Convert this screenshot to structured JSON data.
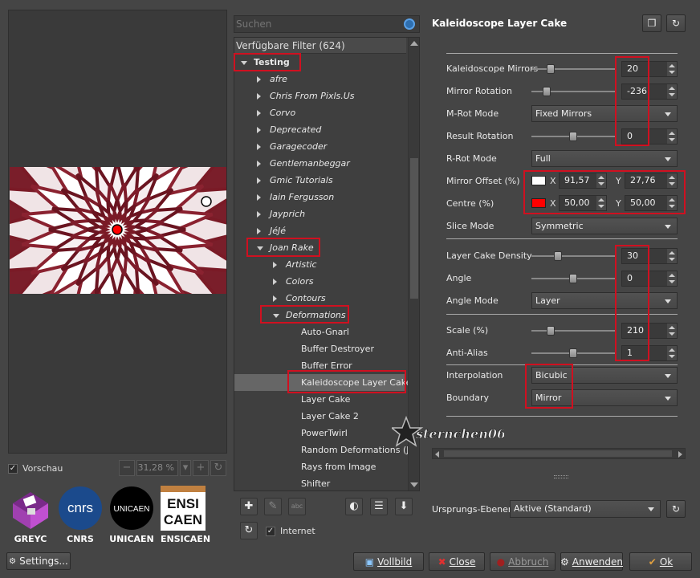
{
  "preview": {
    "checkbox_label": "Vorschau",
    "zoom_value": "31,28 %"
  },
  "logos": [
    {
      "label": "GREYC"
    },
    {
      "label": "CNRS",
      "text": "cnrs"
    },
    {
      "label": "UNICAEN",
      "text": "UNICAEN"
    },
    {
      "label": "ENSICAEN",
      "text1": "ENSI",
      "text2": "CAEN"
    }
  ],
  "settings_label": "Settings...",
  "search": {
    "placeholder": "Suchen"
  },
  "tree": {
    "header": "Verfügbare Filter (624)",
    "items": [
      {
        "label": "Testing",
        "level": 0,
        "expanded": true,
        "bold": true
      },
      {
        "label": "afre",
        "level": 1,
        "expanded": false
      },
      {
        "label": "Chris From Pixls.Us",
        "level": 1,
        "expanded": false
      },
      {
        "label": "Corvo",
        "level": 1,
        "expanded": false
      },
      {
        "label": "Deprecated",
        "level": 1,
        "expanded": false
      },
      {
        "label": "Garagecoder",
        "level": 1,
        "expanded": false
      },
      {
        "label": "Gentlemanbeggar",
        "level": 1,
        "expanded": false
      },
      {
        "label": "Gmic Tutorials",
        "level": 1,
        "expanded": false
      },
      {
        "label": "Iain Fergusson",
        "level": 1,
        "expanded": false
      },
      {
        "label": "Jayprich",
        "level": 1,
        "expanded": false
      },
      {
        "label": "JéJé",
        "level": 1,
        "expanded": false
      },
      {
        "label": "Joan Rake",
        "level": 1,
        "expanded": true
      },
      {
        "label": "Artistic",
        "level": 2,
        "expanded": false
      },
      {
        "label": "Colors",
        "level": 2,
        "expanded": false
      },
      {
        "label": "Contours",
        "level": 2,
        "expanded": false
      },
      {
        "label": "Deformations",
        "level": 2,
        "expanded": true
      },
      {
        "label": "Auto-Gnarl",
        "level": 3
      },
      {
        "label": "Buffer Destroyer",
        "level": 3
      },
      {
        "label": "Buffer Error",
        "level": 3
      },
      {
        "label": "Kaleidoscope Layer Cake",
        "level": 3,
        "selected": true
      },
      {
        "label": "Layer Cake",
        "level": 3
      },
      {
        "label": "Layer Cake 2",
        "level": 3
      },
      {
        "label": "PowerTwirl",
        "level": 3
      },
      {
        "label": "Random Deformations (JR's",
        "level": 3
      },
      {
        "label": "Rays from Image",
        "level": 3
      },
      {
        "label": "Shifter",
        "level": 3
      }
    ]
  },
  "tree_tools": {
    "internet_label": "Internet"
  },
  "filter": {
    "title": "Kaleidoscope Layer Cake",
    "params": {
      "kaleidoscope_mirrors": {
        "label": "Kaleidoscope Mirrors",
        "value": "20",
        "level": 0.2
      },
      "mirror_rotation": {
        "label": "Mirror Rotation",
        "value": "-236",
        "level": 0.15
      },
      "m_rot_mode": {
        "label": "M-Rot Mode",
        "value": "Fixed Mirrors"
      },
      "result_rotation": {
        "label": "Result Rotation",
        "value": "0",
        "level": 0.5
      },
      "r_rot_mode": {
        "label": "R-Rot Mode",
        "value": "Full"
      },
      "mirror_offset": {
        "label": "Mirror Offset (%)",
        "x_label": "X",
        "x": "91,57",
        "y_label": "Y",
        "y": "27,76",
        "color": "#ffffff"
      },
      "centre": {
        "label": "Centre (%)",
        "x_label": "X",
        "x": "50,00",
        "y_label": "Y",
        "y": "50,00",
        "color": "#ff0000"
      },
      "slice_mode": {
        "label": "Slice Mode",
        "value": "Symmetric"
      },
      "layer_cake_density": {
        "label": "Layer Cake Density",
        "value": "30",
        "level": 0.3
      },
      "angle": {
        "label": "Angle",
        "value": "0",
        "level": 0.5
      },
      "angle_mode": {
        "label": "Angle Mode",
        "value": "Layer"
      },
      "scale": {
        "label": "Scale (%)",
        "value": "210",
        "level": 0.2
      },
      "anti_alias": {
        "label": "Anti-Alias",
        "value": "1",
        "level": 0.5
      },
      "interpolation": {
        "label": "Interpolation",
        "value": "Bicubic"
      },
      "boundary": {
        "label": "Boundary",
        "value": "Mirror"
      }
    }
  },
  "layers": {
    "label": "Ursprungs-Ebenen",
    "value": "Aktive (Standard)"
  },
  "buttons": {
    "fullscreen": "Vollbild",
    "close": "Close",
    "cancel": "Abbruch",
    "apply": "Anwenden",
    "ok": "Ok"
  },
  "watermark": "sternchen06",
  "colors": {
    "accent_red": "#d01020",
    "background": "#454545"
  }
}
